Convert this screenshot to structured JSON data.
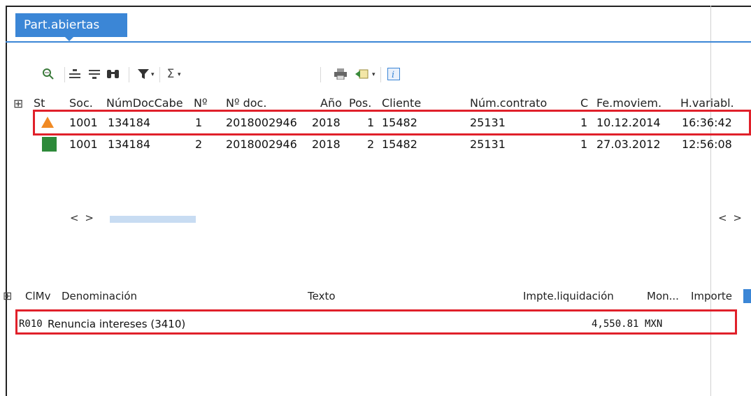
{
  "tab": {
    "label": "Part.abiertas"
  },
  "toolbar": {
    "icons": [
      "details-icon",
      "align-icon",
      "filter-lines-icon",
      "find-icon",
      "funnel-icon",
      "sum-icon",
      "print-icon",
      "export-icon",
      "info-icon"
    ]
  },
  "grid1": {
    "headers": [
      "St",
      "Soc.",
      "NúmDocCabe",
      "Nº",
      "Nº doc.",
      "Año",
      "Pos.",
      "Cliente",
      "Núm.contrato",
      "C",
      "Fe.moviem.",
      "H.variabl."
    ],
    "rows": [
      {
        "status": "warning",
        "soc": "1001",
        "numdoccabe": "134184",
        "no": "1",
        "nodoc": "2018002946",
        "anio": "2018",
        "pos": "1",
        "cliente": "15482",
        "contrato": "25131",
        "c": "1",
        "fecha": "10.12.2014",
        "hora": "16:36:42"
      },
      {
        "status": "ok",
        "soc": "1001",
        "numdoccabe": "134184",
        "no": "2",
        "nodoc": "2018002946",
        "anio": "2018",
        "pos": "2",
        "cliente": "15482",
        "contrato": "25131",
        "c": "1",
        "fecha": "27.03.2012",
        "hora": "12:56:08"
      }
    ],
    "scroll_left": "< >",
    "scroll_right": "< >"
  },
  "grid2": {
    "headers": [
      "ClMv",
      "Denominación",
      "Texto",
      "Impte.liquidación",
      "Mon...",
      "Importe"
    ],
    "row": {
      "clmv": "R010",
      "denominacion": "Renuncia intereses (3410)",
      "texto": "",
      "impte": "4,550.81",
      "mon": "MXN",
      "importe": ""
    }
  },
  "colors": {
    "tab_blue": "#3b86d6",
    "highlight_red": "#e0202a",
    "warn_orange": "#f08a24",
    "ok_green": "#2d8a3a"
  }
}
